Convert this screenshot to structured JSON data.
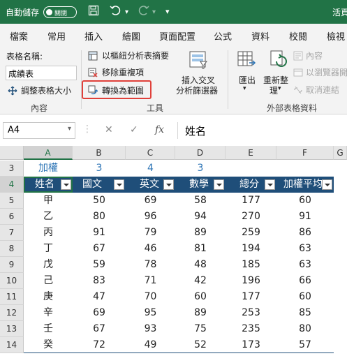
{
  "title_bar": {
    "autosave_label": "自動儲存",
    "toggle_state": "關閉",
    "file_name": "活頁"
  },
  "tabs": [
    "檔案",
    "常用",
    "插入",
    "繪圖",
    "頁面配置",
    "公式",
    "資料",
    "校閱",
    "檢視"
  ],
  "ribbon": {
    "table_name_label": "表格名稱:",
    "table_name_value": "成績表",
    "resize_table": "調整表格大小",
    "group_properties": "內容",
    "pivot_summary": "以樞紐分析表摘要",
    "remove_duplicates": "移除重複項",
    "convert_to_range": "轉換為範圍",
    "insert_slicer_line1": "插入交叉",
    "insert_slicer_line2": "分析篩選器",
    "group_tools": "工具",
    "export": "匯出",
    "refresh_line1": "重新整",
    "refresh_line2": "理",
    "properties": "內容",
    "open_in_browser": "以瀏覽器開",
    "unlink": "取消連結",
    "group_external": "外部表格資料"
  },
  "formula_bar": {
    "name_box": "A4",
    "fx_label": "fx",
    "content": "姓名"
  },
  "sheet": {
    "columns": [
      "A",
      "B",
      "C",
      "D",
      "E",
      "F",
      "G"
    ],
    "rows": [
      "3",
      "4",
      "5",
      "6",
      "7",
      "8",
      "9",
      "10",
      "11",
      "12",
      "13",
      "14"
    ],
    "weight_row": [
      "加權",
      "3",
      "4",
      "3"
    ],
    "headers": [
      "姓名",
      "國文",
      "英文",
      "數學",
      "總分",
      "加權平均"
    ],
    "data": [
      [
        "甲",
        "50",
        "69",
        "58",
        "177",
        "60"
      ],
      [
        "乙",
        "80",
        "96",
        "94",
        "270",
        "91"
      ],
      [
        "丙",
        "91",
        "79",
        "89",
        "259",
        "86"
      ],
      [
        "丁",
        "67",
        "46",
        "81",
        "194",
        "63"
      ],
      [
        "戊",
        "59",
        "78",
        "48",
        "185",
        "63"
      ],
      [
        "己",
        "83",
        "71",
        "42",
        "196",
        "66"
      ],
      [
        "庚",
        "47",
        "70",
        "60",
        "177",
        "60"
      ],
      [
        "辛",
        "69",
        "95",
        "89",
        "253",
        "85"
      ],
      [
        "壬",
        "67",
        "93",
        "75",
        "235",
        "80"
      ],
      [
        "癸",
        "72",
        "49",
        "52",
        "173",
        "57"
      ]
    ]
  },
  "colors": {
    "brand": "#217346",
    "table_header": "#1f4e79",
    "highlight": "#e0403a",
    "weight_text": "#2e75b6"
  }
}
